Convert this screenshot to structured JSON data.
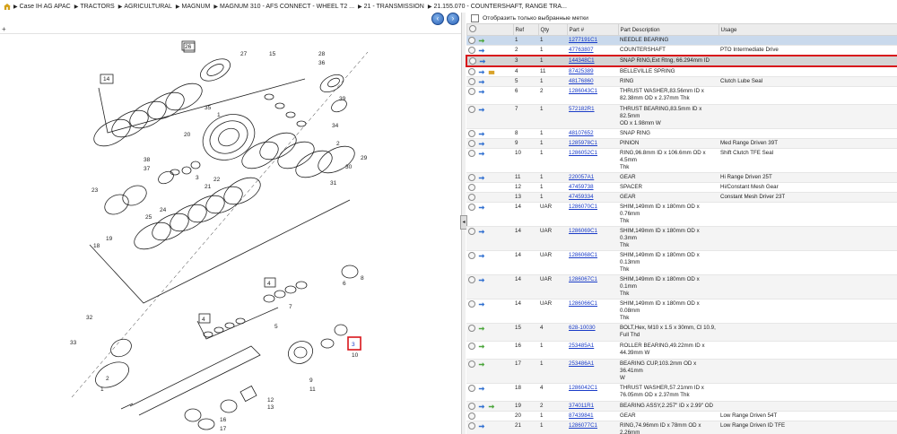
{
  "breadcrumb": [
    "Case IH AG APAC",
    "TRACTORS",
    "AGRICULTURAL",
    "MAGNUM",
    "MAGNUM 310 - AFS CONNECT - WHEEL T2 ...",
    "21 - TRANSMISSION",
    "21.155.070 - COUNTERSHAFT, RANGE TRA..."
  ],
  "filter_label": "Отобразить только выбранные метки",
  "columns": [
    "Ref",
    "Qty",
    "Part #",
    "Part Description",
    "Usage"
  ],
  "rows": [
    {
      "ref": "1",
      "qty": "1",
      "part": "1277191C1",
      "desc": [
        "NEEDLE BEARING"
      ],
      "usage": "",
      "icons": [
        "circle",
        "green"
      ],
      "state": "hl"
    },
    {
      "ref": "2",
      "qty": "1",
      "part": "47763807",
      "desc": [
        "COUNTERSHAFT"
      ],
      "usage": "PTO Intermediate Drive",
      "icons": [
        "circle",
        "blue"
      ],
      "state": ""
    },
    {
      "ref": "3",
      "qty": "1",
      "part": "144348C1",
      "desc": [
        "SNAP RING,Ext Rtng, 66.294mm ID"
      ],
      "usage": "",
      "icons": [
        "circle",
        "blue"
      ],
      "state": "sel"
    },
    {
      "ref": "4",
      "qty": "11",
      "part": "87425389",
      "desc": [
        "BELLEVILLE SPRING"
      ],
      "usage": "",
      "icons": [
        "circle",
        "blue",
        "gold"
      ],
      "state": ""
    },
    {
      "ref": "5",
      "qty": "1",
      "part": "48176860",
      "desc": [
        "RING"
      ],
      "usage": "Clutch Lube Seal",
      "icons": [
        "circle",
        "blue"
      ],
      "state": "alt"
    },
    {
      "ref": "6",
      "qty": "2",
      "part": "1286043C1",
      "desc": [
        "THRUST WASHER,83.56mm ID x",
        "82.38mm OD x 2.37mm Thk"
      ],
      "usage": "",
      "icons": [
        "circle",
        "blue"
      ],
      "state": ""
    },
    {
      "ref": "7",
      "qty": "1",
      "part": "572182R1",
      "desc": [
        "THRUST BEARING,83.5mm ID x 82.5mm",
        "OD x 1.98mm W"
      ],
      "usage": "",
      "icons": [
        "circle",
        "blue"
      ],
      "state": "alt"
    },
    {
      "ref": "8",
      "qty": "1",
      "part": "48107652",
      "desc": [
        "SNAP RING"
      ],
      "usage": "",
      "icons": [
        "circle",
        "blue"
      ],
      "state": ""
    },
    {
      "ref": "9",
      "qty": "1",
      "part": "1285978C1",
      "desc": [
        "PINION"
      ],
      "usage": "Med Range Driven 39T",
      "icons": [
        "circle",
        "blue"
      ],
      "state": "alt"
    },
    {
      "ref": "10",
      "qty": "1",
      "part": "1286052C1",
      "desc": [
        "RING,96.8mm ID x 106.6mm OD x 4.5mm",
        "Thk"
      ],
      "usage": "Shift Clutch TFE Seal",
      "icons": [
        "circle",
        "blue"
      ],
      "state": ""
    },
    {
      "ref": "11",
      "qty": "1",
      "part": "220057A1",
      "desc": [
        "GEAR"
      ],
      "usage": "Hi Range Driven 25T",
      "icons": [
        "circle",
        "blue"
      ],
      "state": "alt"
    },
    {
      "ref": "12",
      "qty": "1",
      "part": "47459738",
      "desc": [
        "SPACER"
      ],
      "usage": "Hi/Constant Mesh Gear",
      "icons": [
        "circle"
      ],
      "state": ""
    },
    {
      "ref": "13",
      "qty": "1",
      "part": "47459334",
      "desc": [
        "GEAR"
      ],
      "usage": "Constant Mesh Driver 23T",
      "icons": [
        "circle"
      ],
      "state": "alt"
    },
    {
      "ref": "14",
      "qty": "UAR",
      "part": "1286070C1",
      "desc": [
        "SHIM,149mm ID x 180mm OD x 0.76mm",
        "Thk"
      ],
      "usage": "",
      "icons": [
        "circle",
        "blue"
      ],
      "state": ""
    },
    {
      "ref": "14",
      "qty": "UAR",
      "part": "1286069C1",
      "desc": [
        "SHIM,149mm ID x 180mm OD x 0.3mm",
        "Thk"
      ],
      "usage": "",
      "icons": [
        "circle",
        "blue"
      ],
      "state": "alt"
    },
    {
      "ref": "14",
      "qty": "UAR",
      "part": "1286068C1",
      "desc": [
        "SHIM,149mm ID x 180mm OD x 0.13mm",
        "Thk"
      ],
      "usage": "",
      "icons": [
        "circle",
        "blue"
      ],
      "state": ""
    },
    {
      "ref": "14",
      "qty": "UAR",
      "part": "1286067C1",
      "desc": [
        "SHIM,149mm ID x 180mm OD x 0.1mm",
        "Thk"
      ],
      "usage": "",
      "icons": [
        "circle",
        "blue"
      ],
      "state": "alt"
    },
    {
      "ref": "14",
      "qty": "UAR",
      "part": "1286066C1",
      "desc": [
        "SHIM,149mm ID x 180mm OD x 0.08mm",
        "Thk"
      ],
      "usage": "",
      "icons": [
        "circle",
        "blue"
      ],
      "state": ""
    },
    {
      "ref": "15",
      "qty": "4",
      "part": "628-10030",
      "desc": [
        "BOLT,Hex, M10 x 1.5 x 30mm, Cl 10.9,",
        "Full Thd"
      ],
      "usage": "",
      "icons": [
        "circle",
        "green"
      ],
      "state": "alt"
    },
    {
      "ref": "16",
      "qty": "1",
      "part": "253485A1",
      "desc": [
        "ROLLER BEARING,49.22mm ID x",
        "44.39mm W"
      ],
      "usage": "",
      "icons": [
        "circle",
        "green"
      ],
      "state": ""
    },
    {
      "ref": "17",
      "qty": "1",
      "part": "253486A1",
      "desc": [
        "BEARING CUP,103.2mm OD x 36.41mm",
        "W"
      ],
      "usage": "",
      "icons": [
        "circle",
        "green"
      ],
      "state": "alt"
    },
    {
      "ref": "18",
      "qty": "4",
      "part": "1286042C1",
      "desc": [
        "THRUST WASHER,57.21mm ID x",
        "76.05mm OD x 2.37mm Thk"
      ],
      "usage": "",
      "icons": [
        "circle",
        "blue"
      ],
      "state": ""
    },
    {
      "ref": "19",
      "qty": "2",
      "part": "374011R1",
      "desc": [
        "BEARING ASSY,2.257\" ID x 2.99\" OD"
      ],
      "usage": "",
      "icons": [
        "circle",
        "blue",
        "green"
      ],
      "state": "alt"
    },
    {
      "ref": "20",
      "qty": "1",
      "part": "87439841",
      "desc": [
        "GEAR"
      ],
      "usage": "Low Range Driven 54T",
      "icons": [
        "circle"
      ],
      "state": ""
    },
    {
      "ref": "21",
      "qty": "1",
      "part": "1286077C1",
      "desc": [
        "RING,74.96mm ID x 78mm OD x 2.26mm",
        "Thk"
      ],
      "usage": "Low Range Driven ID TFE",
      "icons": [
        "circle",
        "blue"
      ],
      "state": "alt"
    }
  ],
  "callouts": [
    "26",
    "27",
    "15",
    "28",
    "36",
    "14",
    "39",
    "35",
    "1",
    "20",
    "34",
    "2",
    "38",
    "37",
    "3",
    "21",
    "22",
    "31",
    "30",
    "29",
    "23",
    "24",
    "25",
    "19",
    "18",
    "4",
    "6",
    "8",
    "4",
    "7",
    "32",
    "5",
    "3",
    "33",
    "10",
    "9",
    "2",
    "11",
    "1",
    "12",
    "13",
    "16",
    "17"
  ]
}
